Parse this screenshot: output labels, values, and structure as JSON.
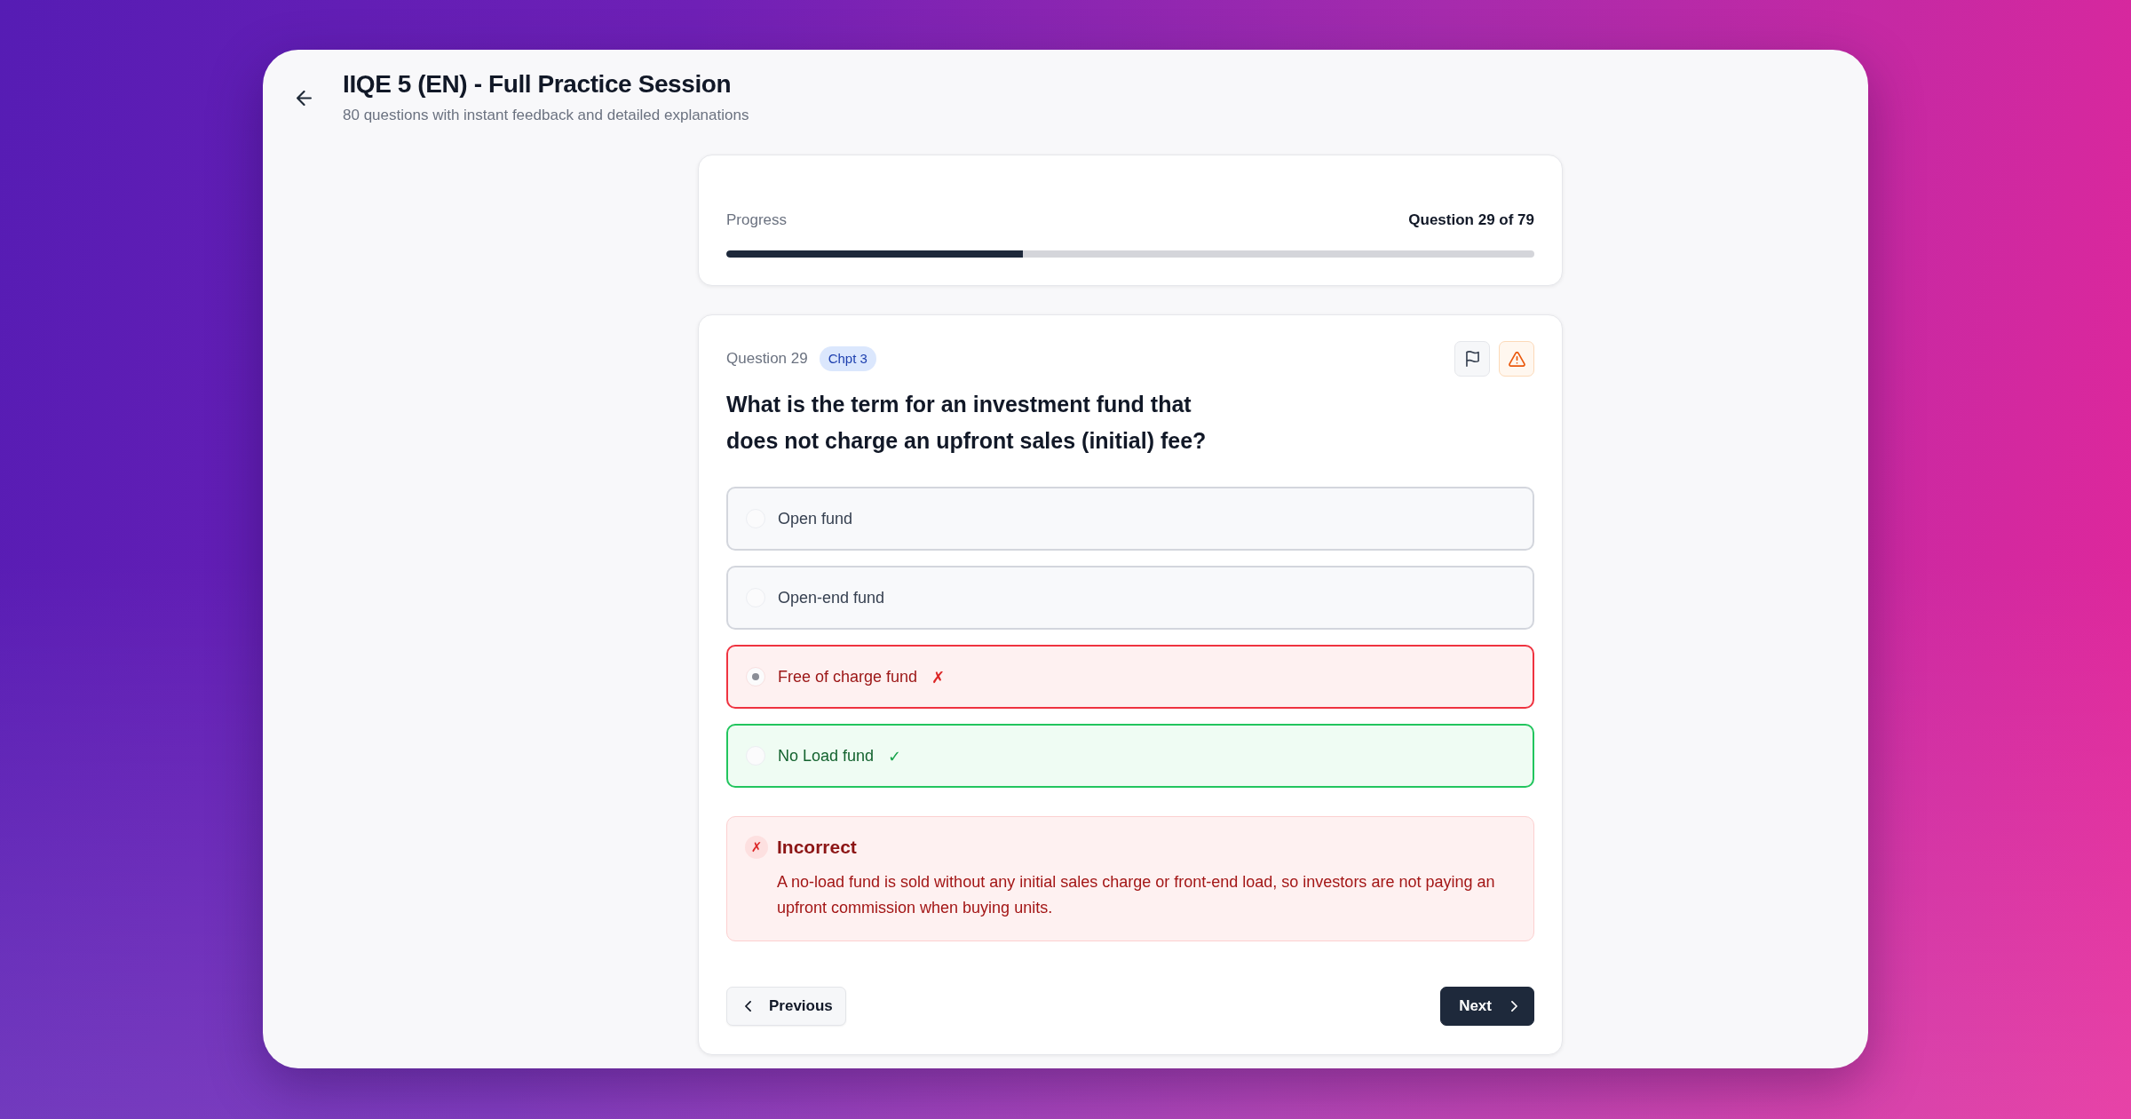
{
  "header": {
    "title": "IIQE 5 (EN) - Full Practice Session",
    "subtitle": "80 questions with instant feedback and detailed explanations"
  },
  "progress": {
    "label": "Progress",
    "counter": "Question 29 of 79",
    "level": 0.367
  },
  "question": {
    "number": "Question 29",
    "chapter": "Chpt 3",
    "text": "What is the term for an investment fund that does not charge an upfront sales (initial) fee?",
    "options": [
      {
        "label": "Open fund",
        "kind": "neutral",
        "selected": false
      },
      {
        "label": "Open-end fund",
        "kind": "neutral",
        "selected": false
      },
      {
        "label": "Free of charge fund",
        "kind": "wrong",
        "selected": true,
        "mark": "✗"
      },
      {
        "label": "No Load fund",
        "kind": "correct",
        "selected": false,
        "mark": "✓"
      }
    ]
  },
  "feedback": {
    "kind": "incorrect",
    "icon": "✗",
    "title": "Incorrect",
    "text": "A no-load fund is sold without any initial sales charge or front-end load, so investors are not paying an upfront commission when buying units."
  },
  "navigation": {
    "previous": "Previous",
    "next": "Next"
  }
}
